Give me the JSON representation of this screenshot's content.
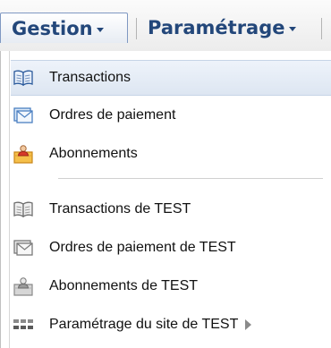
{
  "navbar": {
    "menus": [
      {
        "label": "Gestion"
      },
      {
        "label": "Paramétrage"
      }
    ]
  },
  "dropdown": {
    "items": [
      {
        "label": "Transactions",
        "icon": "book-icon"
      },
      {
        "label": "Ordres de paiement",
        "icon": "payment-order-icon"
      },
      {
        "label": "Abonnements",
        "icon": "subscription-folder-icon"
      },
      {
        "label": "Transactions de TEST",
        "icon": "book-icon"
      },
      {
        "label": "Ordres de paiement de TEST",
        "icon": "payment-order-icon"
      },
      {
        "label": "Abonnements de TEST",
        "icon": "subscription-folder-icon"
      },
      {
        "label": "Paramétrage du site de TEST",
        "icon": "site-grid-icon"
      }
    ]
  },
  "colors": {
    "nav_text": "#23477a",
    "active_item_bg": "#dde6f2"
  }
}
